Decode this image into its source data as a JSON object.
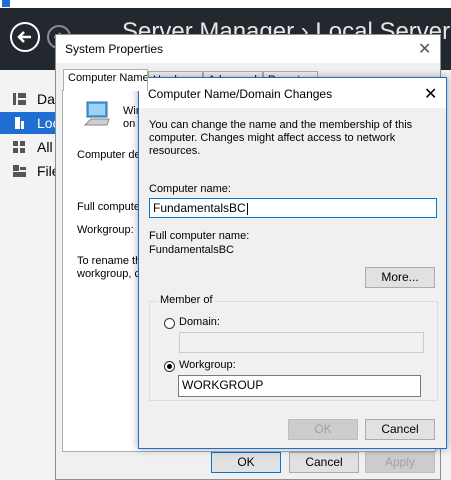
{
  "server_manager": {
    "heading": "Server Manager › Local Server",
    "nav": [
      {
        "label": "Das",
        "icon": "dashboard-icon"
      },
      {
        "label": "Loc",
        "icon": "server-icon"
      },
      {
        "label": "All",
        "icon": "servers-icon"
      },
      {
        "label": "File",
        "icon": "file-services-icon"
      }
    ]
  },
  "system_properties": {
    "title": "System Properties",
    "tabs": [
      "Computer Name",
      "Hardware",
      "Advanced",
      "Remote"
    ],
    "panel": {
      "windows_text_1": "Win",
      "windows_text_2": "on t",
      "computer_description": "Computer des",
      "full_computer": "Full computer",
      "workgroup": "Workgroup:",
      "rename_1": "To rename thi",
      "rename_2": "workgroup, cli"
    },
    "buttons": {
      "ok": "OK",
      "cancel": "Cancel",
      "apply": "Apply"
    }
  },
  "name_changes": {
    "title": "Computer Name/Domain Changes",
    "description": "You can change the name and the membership of this computer. Changes might affect access to network resources.",
    "computer_name_label": "Computer name:",
    "computer_name_value": "FundamentalsBC",
    "full_name_label": "Full computer name:",
    "full_name_value": "FundamentalsBC",
    "more_button": "More...",
    "member_of": "Member of",
    "domain_label": "Domain:",
    "domain_value": "",
    "workgroup_label": "Workgroup:",
    "workgroup_value": "WORKGROUP",
    "selected_membership": "workgroup",
    "buttons": {
      "ok": "OK",
      "cancel": "Cancel"
    }
  },
  "colors": {
    "accent": "#1e6fd1",
    "banner": "#23282e"
  }
}
